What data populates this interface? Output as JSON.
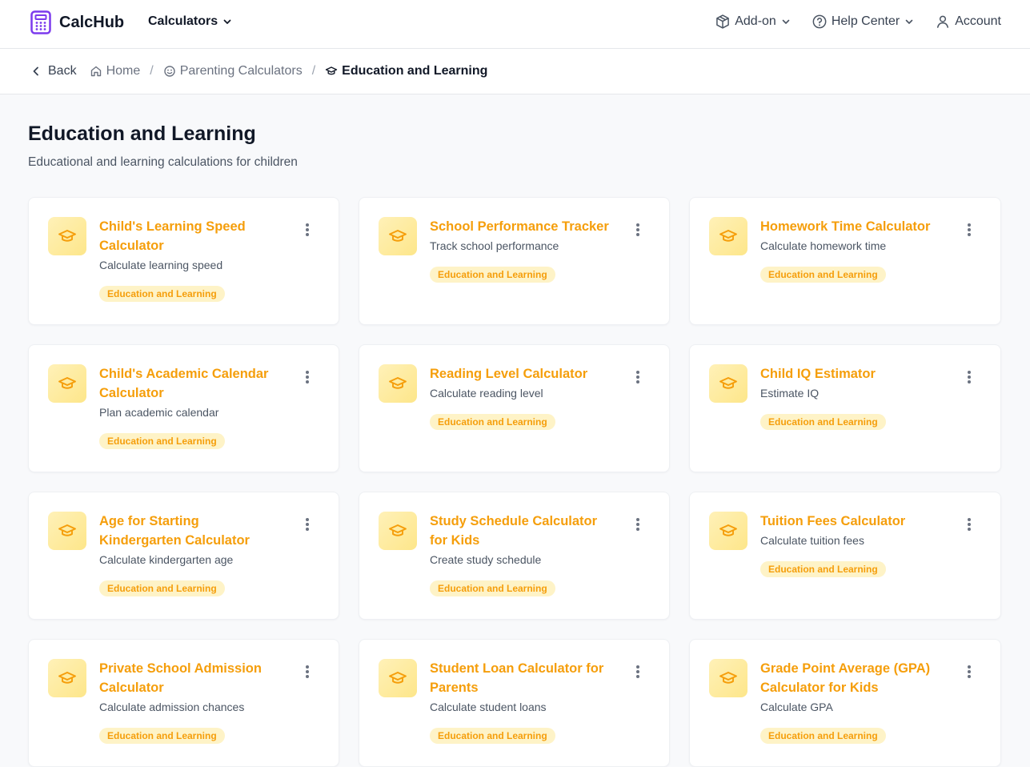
{
  "app": {
    "name": "CalcHub"
  },
  "nav": {
    "calculators_label": "Calculators",
    "addon_label": "Add-on",
    "help_label": "Help Center",
    "account_label": "Account"
  },
  "breadcrumb": {
    "back": "Back",
    "home": "Home",
    "parent": "Parenting Calculators",
    "current": "Education and Learning",
    "separator": "/"
  },
  "page": {
    "title": "Education and Learning",
    "subtitle": "Educational and learning calculations for children"
  },
  "colors": {
    "accent": "#f59e0b",
    "tag_bg": "#fef3c7",
    "icon_bg": "#fde68a",
    "logo": "#7c3aed"
  },
  "cards": [
    {
      "title": "Child's Learning Speed Calculator",
      "description": "Calculate learning speed",
      "tag": "Education and Learning",
      "icon": "graduation-cap-icon"
    },
    {
      "title": "School Performance Tracker",
      "description": "Track school performance",
      "tag": "Education and Learning",
      "icon": "graduation-cap-icon"
    },
    {
      "title": "Homework Time Calculator",
      "description": "Calculate homework time",
      "tag": "Education and Learning",
      "icon": "graduation-cap-icon"
    },
    {
      "title": "Child's Academic Calendar Calculator",
      "description": "Plan academic calendar",
      "tag": "Education and Learning",
      "icon": "graduation-cap-icon"
    },
    {
      "title": "Reading Level Calculator",
      "description": "Calculate reading level",
      "tag": "Education and Learning",
      "icon": "graduation-cap-icon"
    },
    {
      "title": "Child IQ Estimator",
      "description": "Estimate IQ",
      "tag": "Education and Learning",
      "icon": "graduation-cap-icon"
    },
    {
      "title": "Age for Starting Kindergarten Calculator",
      "description": "Calculate kindergarten age",
      "tag": "Education and Learning",
      "icon": "graduation-cap-icon"
    },
    {
      "title": "Study Schedule Calculator for Kids",
      "description": "Create study schedule",
      "tag": "Education and Learning",
      "icon": "graduation-cap-icon"
    },
    {
      "title": "Tuition Fees Calculator",
      "description": "Calculate tuition fees",
      "tag": "Education and Learning",
      "icon": "graduation-cap-icon"
    },
    {
      "title": "Private School Admission Calculator",
      "description": "Calculate admission chances",
      "tag": "Education and Learning",
      "icon": "graduation-cap-icon"
    },
    {
      "title": "Student Loan Calculator for Parents",
      "description": "Calculate student loans",
      "tag": "Education and Learning",
      "icon": "graduation-cap-icon"
    },
    {
      "title": "Grade Point Average (GPA) Calculator for Kids",
      "description": "Calculate GPA",
      "tag": "Education and Learning",
      "icon": "graduation-cap-icon"
    }
  ]
}
